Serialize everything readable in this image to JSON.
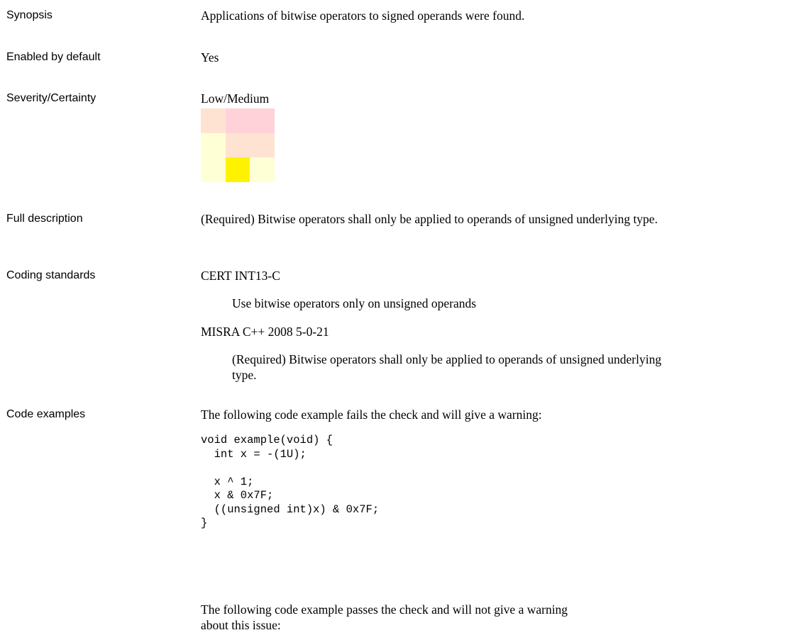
{
  "rows": {
    "synopsis": {
      "label": "Synopsis",
      "text": "Applications of bitwise operators to signed operands were found."
    },
    "enabled": {
      "label": "Enabled by default",
      "text": "Yes"
    },
    "severity": {
      "label": "Severity/Certainty",
      "text": "Low/Medium"
    },
    "full_description": {
      "label": "Full description",
      "text": "(Required) Bitwise operators shall only be applied to operands of unsigned underlying type."
    },
    "coding_standards": {
      "label": "Coding standards",
      "standards": [
        {
          "name": "CERT INT13-C",
          "description": "Use bitwise operators only on unsigned operands"
        },
        {
          "name": "MISRA C++ 2008 5-0-21",
          "description": "(Required) Bitwise operators shall only be applied to operands of unsigned underlying type."
        }
      ]
    },
    "code_examples": {
      "label": "Code examples",
      "fail_intro": "The following code example fails the check and will give a warning:",
      "code_lines": [
        "void example(void) {",
        "  int x = -(1U);",
        "",
        "  x ^ 1;",
        "  x & 0x7F;",
        "  ((unsigned int)x) & 0x7F;",
        "}"
      ],
      "pass_intro": "The following code example passes the check and will not give a warning about this issue:"
    }
  },
  "severity_grid": {
    "colors": [
      [
        "#ffe3d2",
        "#ffd2da",
        "#ffd2da"
      ],
      [
        "#ffffd6",
        "#ffe3d2",
        "#ffe3d2"
      ],
      [
        "#ffffd6",
        "#fff200",
        "#ffffd6"
      ]
    ]
  }
}
